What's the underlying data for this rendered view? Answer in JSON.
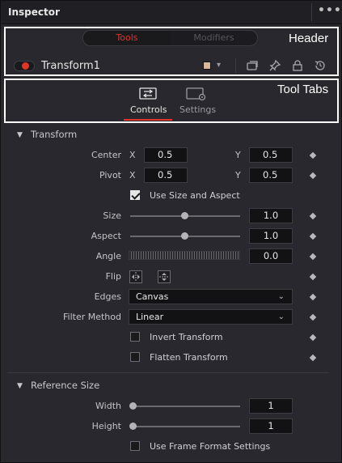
{
  "window": {
    "title": "Inspector",
    "more_icon": "ellipsis-icon"
  },
  "annotations": {
    "header_label": "Header",
    "tool_tabs_label": "Tool Tabs"
  },
  "header": {
    "tabs": [
      {
        "label": "Tools",
        "active": true
      },
      {
        "label": "Modifiers",
        "active": false
      }
    ],
    "node_name": "Transform1",
    "node_enabled": true,
    "node_color": "#d8b89a",
    "icons": [
      "versions-icon",
      "pin-icon",
      "lock-icon",
      "reset-icon"
    ]
  },
  "tool_tabs": [
    {
      "label": "Controls",
      "active": true,
      "icon": "controls-icon"
    },
    {
      "label": "Settings",
      "active": false,
      "icon": "settings-icon"
    }
  ],
  "accent_color": "#e0342b",
  "transform": {
    "title": "Transform",
    "center": {
      "label": "Center",
      "x_axis": "X",
      "x": "0.5",
      "y_axis": "Y",
      "y": "0.5"
    },
    "pivot": {
      "label": "Pivot",
      "x_axis": "X",
      "x": "0.5",
      "y_axis": "Y",
      "y": "0.5"
    },
    "use_size_aspect": {
      "label": "Use Size and Aspect",
      "checked": true
    },
    "size": {
      "label": "Size",
      "value": "1.0"
    },
    "aspect": {
      "label": "Aspect",
      "value": "1.0"
    },
    "angle": {
      "label": "Angle",
      "value": "0.0"
    },
    "flip": {
      "label": "Flip"
    },
    "edges": {
      "label": "Edges",
      "value": "Canvas"
    },
    "filter_method": {
      "label": "Filter Method",
      "value": "Linear"
    },
    "invert_transform": {
      "label": "Invert Transform",
      "checked": false
    },
    "flatten_transform": {
      "label": "Flatten Transform",
      "checked": false
    }
  },
  "reference_size": {
    "title": "Reference Size",
    "width": {
      "label": "Width",
      "value": "1"
    },
    "height": {
      "label": "Height",
      "value": "1"
    },
    "use_frame_format": {
      "label": "Use Frame Format Settings",
      "checked": false
    }
  }
}
